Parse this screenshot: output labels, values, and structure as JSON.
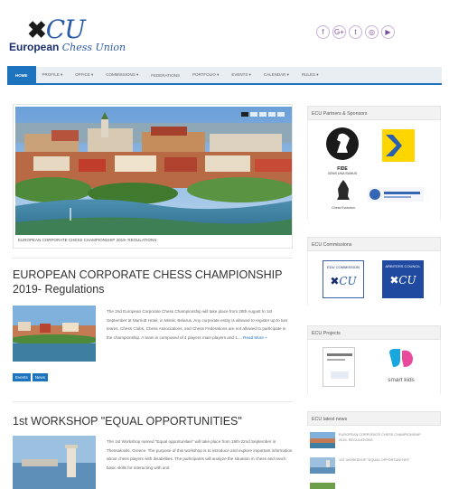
{
  "brand": {
    "mark_left": "✖",
    "mark_cu": "CU",
    "name_bold": "European",
    "name_italic": "Chess Union"
  },
  "social": [
    {
      "icon": "facebook-icon",
      "glyph": "f"
    },
    {
      "icon": "google-plus-icon",
      "glyph": "G+"
    },
    {
      "icon": "twitter-icon",
      "glyph": "t"
    },
    {
      "icon": "instagram-icon",
      "glyph": "◎"
    },
    {
      "icon": "youtube-icon",
      "glyph": "▶"
    }
  ],
  "nav": [
    {
      "label": "HOME",
      "active": true
    },
    {
      "label": "PROFILE ▾"
    },
    {
      "label": "OFFICE ▾"
    },
    {
      "label": "COMMISSIONS ▾"
    },
    {
      "label": "FEDERATIONS"
    },
    {
      "label": "PORTFOLIO ▾"
    },
    {
      "label": "EVENTS ▾"
    },
    {
      "label": "CALENDAR ▾"
    },
    {
      "label": "RULES ▾"
    }
  ],
  "featured": {
    "caption": "EUROPEAN CORPORATE CHESS CHAMPIONSHIP 2019- Regulations"
  },
  "posts": [
    {
      "title_line1": "EUROPEAN CORPORATE CHESS CHAMPIONSHIP",
      "title_line2": "2019- Regulations",
      "excerpt": "The 2nd European Corporate Chess Championship will take place from 29th August to 1st September at Marriott Hotel, in Minsk, Belarus. Any corporate entity is allowed to register up to two teams. Chess Clubs, Chess Associations, and Chess Federations are not allowed to participate in the championship. A team is composed of 4 players main players and 1....",
      "more": "Read More »",
      "tags": [
        "Events",
        "News"
      ]
    },
    {
      "title_line1": "1st WORKSHOP \"EQUAL OPPORTUNITIES\"",
      "excerpt": "The 1st Workshop named \"Equal opportunities\" will take place from 19th-22nd September in Thessaloniki, Greece. The purpose of this workshop is to introduce and explore important information about chess players with disabilities. The participants will analyze the situation in chess and reach basic skills for interacting with and"
    }
  ],
  "sidebar": {
    "partners_title": "ECU Partners & Sponsors",
    "partners": {
      "fide": "FIDE",
      "fide_motto": "GENS UNA SUMUS",
      "chess_evolution": "Chess Evolution",
      "ecu_commission_label": "EDU COMMISSION",
      "arbiters_label": "ARBITERS COUNCIL"
    },
    "commissions_title": "ECU Commissions",
    "projects_title": "ECU Projects",
    "smart_kids": "smart kids",
    "news_title": "ECU latest news",
    "news": [
      "EUROPEAN CORPORATE CHESS CHAMPIONSHIP 2019- Regulations",
      "1st WORKSHOP \"EQUAL OPPORTUNITIES\""
    ]
  },
  "colors": {
    "accent": "#1e73be",
    "brand_blue": "#1a2e6e"
  }
}
